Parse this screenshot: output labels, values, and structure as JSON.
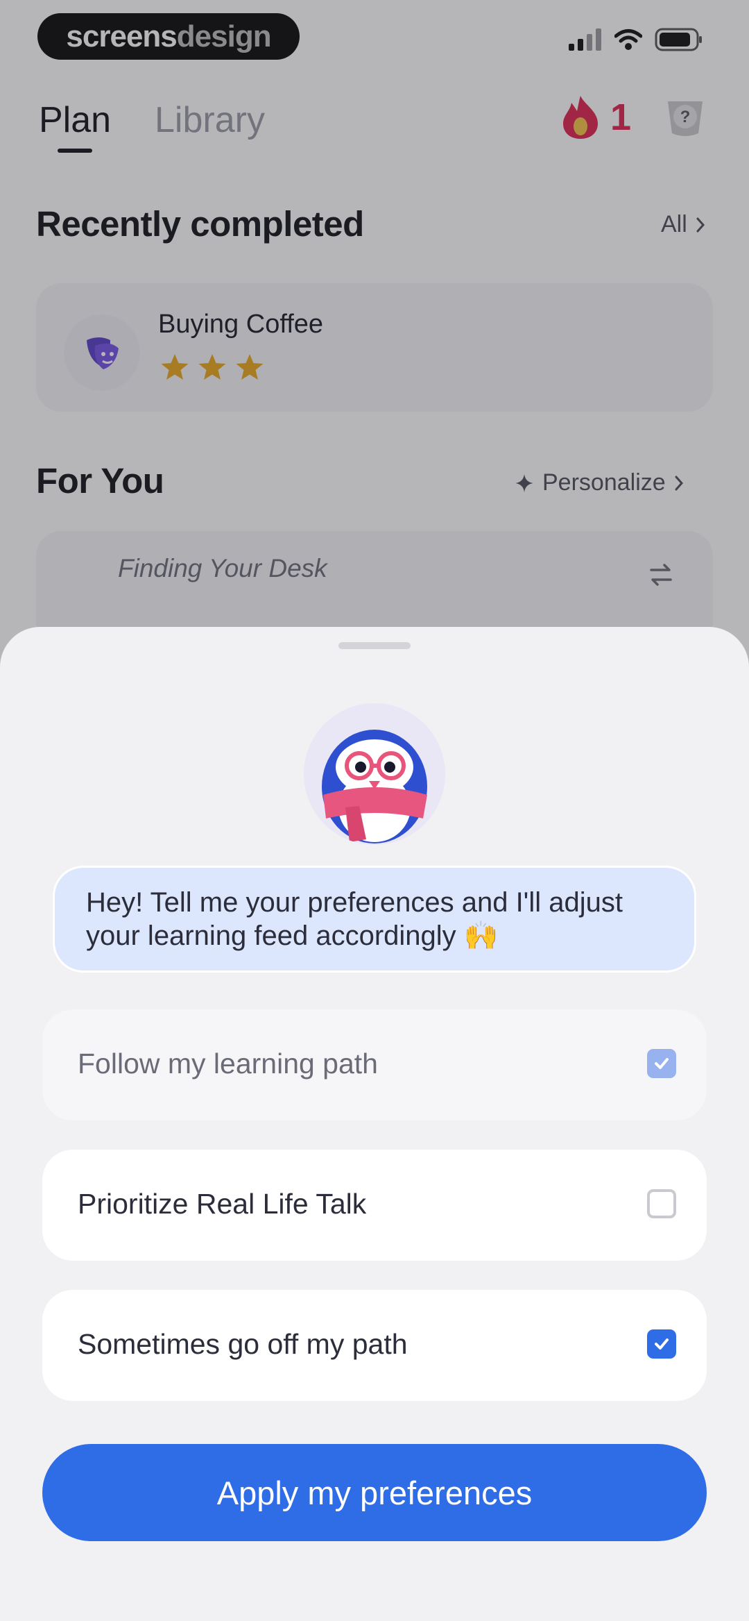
{
  "brand": {
    "part1": "screens",
    "part2": "design"
  },
  "tabs": [
    {
      "label": "Plan",
      "active": true
    },
    {
      "label": "Library",
      "active": false
    }
  ],
  "streak": {
    "count": "1"
  },
  "recently_completed": {
    "title": "Recently completed",
    "link": "All",
    "item": {
      "title": "Buying Coffee",
      "stars": 3
    }
  },
  "for_you": {
    "title": "For You",
    "link": "Personalize",
    "card_title": "Finding Your Desk"
  },
  "sheet": {
    "message": "Hey! Tell me your preferences and I'll adjust your learning feed accordingly 🙌",
    "options": [
      {
        "label": "Follow my learning path",
        "checked": true,
        "disabled": true
      },
      {
        "label": "Prioritize Real Life Talk",
        "checked": false,
        "disabled": false
      },
      {
        "label": "Sometimes go off my path",
        "checked": true,
        "disabled": false
      }
    ],
    "apply_label": "Apply my preferences"
  },
  "colors": {
    "accent": "#2f6de6",
    "streak": "#e0244f",
    "bubble": "#dce6fc"
  }
}
